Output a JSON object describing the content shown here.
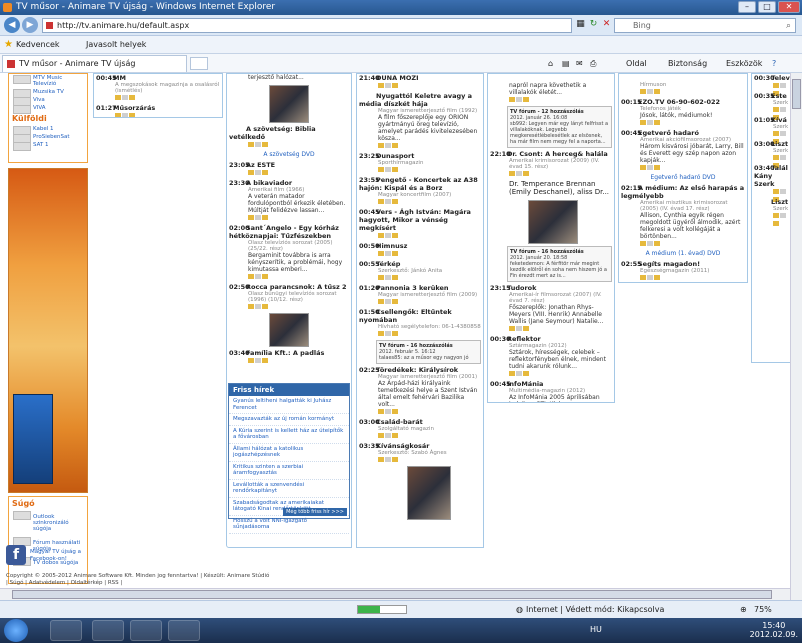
{
  "window": {
    "title": "TV műsor - Animare TV újság - Windows Internet Explorer"
  },
  "address": {
    "url": "http://tv.animare.hu/default.aspx",
    "search_placeholder": "Bing"
  },
  "favorites": {
    "label": "Kedvencek",
    "suggested": "Javasolt helyek"
  },
  "tab": {
    "title": "TV műsor - Animare TV újság"
  },
  "commands": {
    "page": "Oldal",
    "safety": "Biztonság",
    "tools": "Eszközök"
  },
  "status": {
    "zone": "Internet | Védett mód: Kikapcsolva",
    "zoom": "75%",
    "progress": 0.45
  },
  "taskbar": {
    "lang": "HU",
    "time": "15:40",
    "date": "2012.02.09."
  },
  "sidebar": {
    "channels": [
      {
        "name": "MTV Music Televízió"
      },
      {
        "name": "Muzsika TV"
      },
      {
        "name": "Viva"
      },
      {
        "name": "VIVA"
      }
    ],
    "foreign_title": "Külföldi",
    "foreign": [
      {
        "name": "Kabel 1"
      },
      {
        "name": "ProSiebenSat"
      },
      {
        "name": "SAT 1"
      }
    ],
    "help_title": "Súgó",
    "help": [
      "Outlook szinkronizáló súgója",
      "Fórum használati súgója",
      "TV dobos súgója"
    ],
    "facebook": "Magyar TV újság a Facebook-on!"
  },
  "col1": [
    {
      "time": "00:45",
      "title": "MM",
      "sub": "A megszokások magazinja a osalásról (ismétlés)"
    },
    {
      "time": "01:27",
      "title": "Műsorzárás",
      "sub": ""
    }
  ],
  "col2": {
    "top_text": "terjesztő halózat...",
    "items": [
      {
        "time": "",
        "title": "A szövetség: Biblia vetélkedő",
        "sub": ""
      },
      {
        "time": "23:05",
        "title": "Az ESTE",
        "sub": ""
      },
      {
        "time": "23:30",
        "title": "A bikaviador",
        "sub": "Amerikai film (1966)",
        "desc": "A veterán matador fordulópontból érkezik életében. Múltját felidézve lassan..."
      },
      {
        "time": "02:00",
        "title": "Sant´Angelo - Egy kórház hétköznapjai: Tűzfészekben",
        "sub": "Olasz televíziós sorozat (2005) (25/22. rész)",
        "desc": "Bergaminit továbbra is arra kényszerítik, a problémái, hogy kimutassa emberi..."
      },
      {
        "time": "02:50",
        "title": "Rocca parancsnok: A tűsz 2",
        "sub": "Olasz bűnügyi televíziós sorozat (1996) (10/12. rész)"
      },
      {
        "time": "03:40",
        "title": "Família Kft.: A padlás",
        "sub": ""
      }
    ],
    "dvd_link": "A szövetség DVD"
  },
  "news": {
    "title": "Friss hírek",
    "items": [
      "Gyanús leltiheni halgatták ki Juhász Ferencet",
      "Megszavazták az új román kormányt",
      "A Kúria szerint is kellett ház az úteipítők a fővárosban",
      "Állami hálózat a katolikus jogászhépzésnek",
      "Kritikus szinten a szerbiai áramfogyasztás",
      "Levállották a szenvendési rendőrkapitányt",
      "Szabadságodtak az amerikaiakat látogató Kinai rendőrtönkött",
      "Hosszú a volt NNI-igazgató sűnjadásoma"
    ],
    "more": "Még több friss hír >>>"
  },
  "col3": [
    {
      "time": "21:40",
      "title": "DUNA MOZI",
      "sub": ""
    },
    {
      "time": "",
      "title": "Nyugattól Keletre avagy a média díszkét hája",
      "sub": "Magyar ismeretterjesztő film (1992)",
      "desc": "A film főszereplője egy ORION gyártmányú öreg televízió, amelyet parádés kivitelezesében kösza..."
    },
    {
      "time": "23:25",
      "title": "Dunasport",
      "sub": "Sporthírmagazin"
    },
    {
      "time": "23:55",
      "title": "Pengető - Koncertek az A38 hajón: Kispál és a Borz",
      "sub": "Magyar koncertfilm (2007)"
    },
    {
      "time": "00:45",
      "title": "Vers - Ágh István: Magára hagyott, Mikor a vénség megkísért",
      "sub": ""
    },
    {
      "time": "00:50",
      "title": "Himnusz",
      "sub": ""
    },
    {
      "time": "00:55",
      "title": "Térkép",
      "sub": "Szerkesztő: Jánkó Anita"
    },
    {
      "time": "01:20",
      "title": "Pannonia 3 kerüken",
      "sub": "Magyar ismeretterjesztő film (2009)"
    },
    {
      "time": "01:50",
      "title": "Csellengők: Eltűntek nyomában",
      "sub": "Hívható segélytelefon: 06-1-4380858"
    },
    {
      "time": "02:25",
      "title": "Töredékek: Királysírok",
      "sub": "Magyar ismeretterjesztő film (2001)",
      "desc": "Az Árpád-házi királyaink temetkezési helye a Szent István által emelt fehérvári Bazilika volt..."
    },
    {
      "time": "03:00",
      "title": "Család-barát",
      "sub": "Szolgáltató magazin"
    },
    {
      "time": "03:35",
      "title": "Kívánságkosár",
      "sub": "Szerkesztő: Szabó Ágnes"
    }
  ],
  "col3_forum": {
    "title": "TV fórum - 16 hozzászólás",
    "date": "2012. február 5. 16:12",
    "text": "talaes85: az a műsor egy nagyon jó"
  },
  "col4": [
    {
      "time": "",
      "title": "",
      "sub": "",
      "desc": "napról napra követhetik a villalakók életét..."
    },
    {
      "time": "22:10",
      "title": "Dr. Csont: A herceg& halála",
      "sub": "Amerikai krimisorozat (2009) (IV. évad 15. rész)"
    },
    {
      "time": "23:15",
      "title": "Tudorok",
      "sub": "Amerikai-ír filmsorozat (2007) (IV. évad 7. rész)",
      "desc": "Főszereplők: Jonathan Rhys-Meyers (VIII. Henrik) Annabelle Wallis (Jane Seymour) Natalie..."
    },
    {
      "time": "00:30",
      "title": "Reflektor",
      "sub": "Sztármagazin (2012)",
      "desc": "Sztárok, hírességek, celebek – reflektorfényben élnek, mindent tudni akarunk rólunk..."
    },
    {
      "time": "00:45",
      "title": "InfoMánia",
      "sub": "Multimédia-magazin (2012)",
      "desc": "Az InfoMánia 2005 áprilisában indult az RTL Klubon - mindazoknak, akik..."
    }
  ],
  "col4_forum1": {
    "title": "TV fórum - 12 hozzászólás",
    "date": "2012. január 26. 16:08",
    "text": "sb992: Legyen már egy lányt felfrisst a villalakóknak. Legyebb megkeresétlébelesétlek az elsösnek, ha már film nem megy fel a naporta..."
  },
  "col4_forum2": {
    "title": "TV fórum - 16 hozzászólás",
    "date": "2012. január 20. 18:58",
    "text": "feketedemon: A férfitör már megint kezdik elölről én soha nem hiszem jó a Fin érezdt mert az is..."
  },
  "col4_desc": "Dr. Temperance Brennan (Emily Deschanel), aliss Dr...",
  "col5": [
    {
      "time": "",
      "title": "",
      "sub": "Hírmuson"
    },
    {
      "time": "00:15",
      "title": "EZO.TV 06-90-602-022",
      "sub": "Telefonos játék",
      "desc": "Jósok, látók, médiumok!"
    },
    {
      "time": "00:45",
      "title": "Egetverő hadaró",
      "sub": "Amerikai akciófilmsorozat (2007)",
      "desc": "Három kisvárosi jóbarát, Larry, Bill és Everett egy szép napon azon kapják..."
    },
    {
      "time": "02:15",
      "title": "A médium: Az első harapás a legmélyebb",
      "sub": "Amerikai misztikus krimisorozat (2005) (IV. évad 17. rész)",
      "desc": "Allison, Cynthia egyik régen megoldott ügyéről álmodik, azért felkeresi a volt kollégáját a börtönben..."
    },
    {
      "time": "02:55",
      "title": "Segíts magadon!",
      "sub": "Egészségmagazin (2011)"
    },
    {
      "time": "03:20",
      "title": "Vers éjfélkor",
      "sub": ""
    }
  ],
  "col5_links": [
    "Egetverő hadaró DVD",
    "A médium (1. évad) DVD"
  ],
  "col6": [
    {
      "time": "00:30",
      "title": "Telev",
      "sub": ""
    },
    {
      "time": "00:35",
      "title": "Este",
      "sub": "Szerk"
    },
    {
      "time": "01:05",
      "title": "Kívá",
      "sub": "Szerk"
    },
    {
      "time": "03:00",
      "title": "Liszt",
      "sub": "Szerk"
    },
    {
      "time": "03:40",
      "title": "Talál Kány Szerk",
      "sub": ""
    },
    {
      "time": "",
      "title": "Liszt",
      "sub": "Szerk"
    }
  ],
  "footer": {
    "copyright": "Copyright © 2005-2012 Animare Software Kft. Minden jog fenntartva! | Készült: Animare Stúdió",
    "links": "| Súgó | Adatvédelem | Oldaltérkép | RSS |"
  }
}
